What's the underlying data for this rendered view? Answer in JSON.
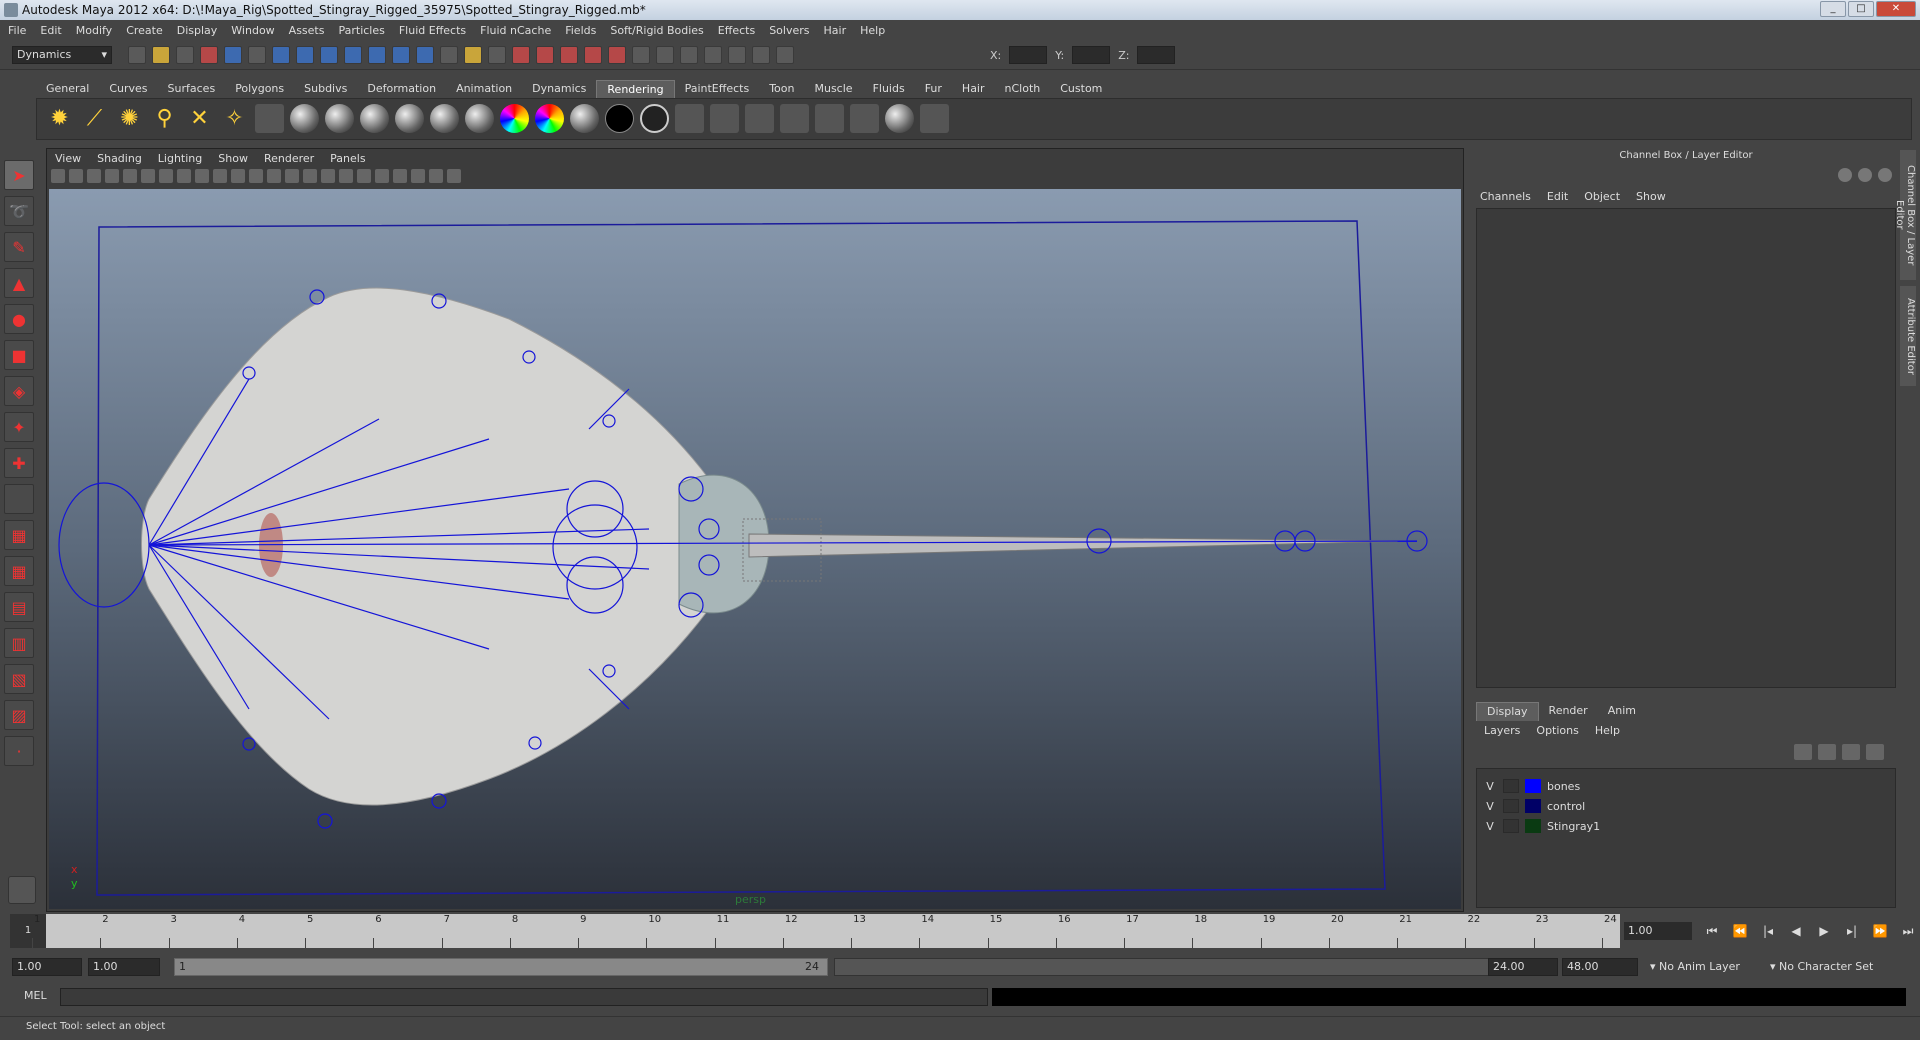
{
  "window": {
    "title": "Autodesk Maya 2012 x64: D:\\!Maya_Rig\\Spotted_Stingray_Rigged_35975\\Spotted_Stingray_Rigged.mb*"
  },
  "menubar": [
    "File",
    "Edit",
    "Modify",
    "Create",
    "Display",
    "Window",
    "Assets",
    "Particles",
    "Fluid Effects",
    "Fluid nCache",
    "Fields",
    "Soft/Rigid Bodies",
    "Effects",
    "Solvers",
    "Hair",
    "Help"
  ],
  "toolbar": {
    "mode": "Dynamics",
    "x_label": "X:",
    "y_label": "Y:",
    "z_label": "Z:"
  },
  "shelf": {
    "tabs": [
      "General",
      "Curves",
      "Surfaces",
      "Polygons",
      "Subdivs",
      "Deformation",
      "Animation",
      "Dynamics",
      "Rendering",
      "PaintEffects",
      "Toon",
      "Muscle",
      "Fluids",
      "Fur",
      "Hair",
      "nCloth",
      "Custom"
    ],
    "active_tab": "Rendering"
  },
  "viewport": {
    "menu": [
      "View",
      "Shading",
      "Lighting",
      "Show",
      "Renderer",
      "Panels"
    ],
    "camera_label": "persp",
    "axis_x": "x",
    "axis_y": "y"
  },
  "channel_box": {
    "title": "Channel Box / Layer Editor",
    "menu": [
      "Channels",
      "Edit",
      "Object",
      "Show"
    ]
  },
  "layer_editor": {
    "tabs": [
      "Display",
      "Render",
      "Anim"
    ],
    "active_tab": "Display",
    "menu": [
      "Layers",
      "Options",
      "Help"
    ],
    "layers": [
      {
        "visible": "V",
        "name": "bones",
        "color": "#0000ff"
      },
      {
        "visible": "V",
        "name": "control",
        "color": "#000066"
      },
      {
        "visible": "V",
        "name": "Stingray1",
        "color": "#0a3a12"
      }
    ]
  },
  "side_tabs": [
    "Channel Box / Layer Editor",
    "Attribute Editor"
  ],
  "timeline": {
    "ticks": [
      "1",
      "2",
      "3",
      "4",
      "5",
      "6",
      "7",
      "8",
      "9",
      "10",
      "11",
      "12",
      "13",
      "14",
      "15",
      "16",
      "17",
      "18",
      "19",
      "20",
      "21",
      "22",
      "23",
      "24"
    ],
    "current_frame": "1",
    "current_time_field": "1.00"
  },
  "range": {
    "start_time": "1.00",
    "playback_start": "1.00",
    "slider_start": "1",
    "slider_end": "24",
    "playback_end": "24.00",
    "end_time": "48.00",
    "anim_layer": "No Anim Layer",
    "character_set": "No Character Set"
  },
  "command_line": {
    "label": "MEL"
  },
  "status": {
    "text": "Select Tool: select an object"
  }
}
